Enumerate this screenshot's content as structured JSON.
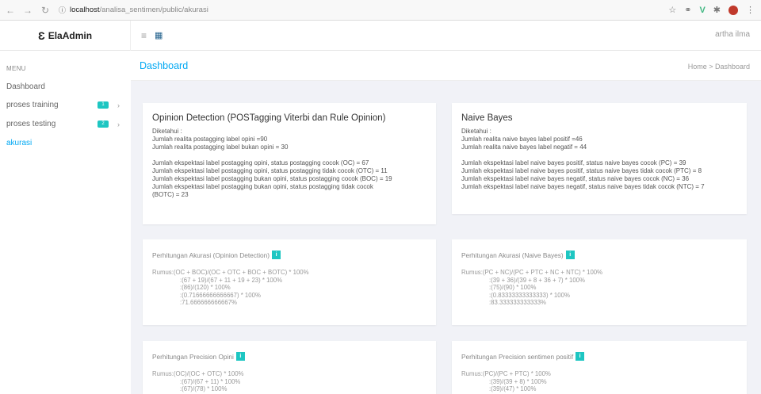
{
  "browser": {
    "host": "localhost",
    "path": "/analisa_sentimen/public/akurasi"
  },
  "header": {
    "brand": "ElaAdmin",
    "user": "artha ilma"
  },
  "sidebar": {
    "menu_title": "MENU",
    "items": [
      {
        "label": "Dashboard"
      },
      {
        "label": "proses training",
        "badge": "1"
      },
      {
        "label": "proses testing",
        "badge": "2"
      },
      {
        "label": "akurasi"
      }
    ]
  },
  "page": {
    "title": "Dashboard",
    "breadcrumb": "Home > Dashboard"
  },
  "cards": {
    "opinion": {
      "title": "Opinion Detection (POSTagging Viterbi dan Rule Opinion)",
      "lines": [
        "Diketahui :",
        "Jumlah realita postagging label opini =90",
        "Jumlah realita postagging label bukan opini = 30",
        "",
        "Jumlah ekspektasi label postagging opini, status postagging cocok (OC) = 67",
        "Jumlah ekspektasi label postagging opini, status postagging tidak cocok (OTC) = 11",
        "Jumlah ekspektasi label postagging bukan opini, status postagging cocok (BOC) = 19",
        "Jumlah ekspektasi label postagging bukan opini, status postagging tidak cocok",
        "(BOTC) = 23"
      ]
    },
    "naive": {
      "title": "Naive Bayes",
      "lines": [
        "Diketahui :",
        "Jumlah realita naive bayes label positif =46",
        "Jumlah realita naive bayes label negatif = 44",
        "",
        "Jumlah ekspektasi label naive bayes positif, status naive bayes cocok (PC) = 39",
        "Jumlah ekspektasi label naive bayes positif, status naive bayes tidak cocok (PTC) = 8",
        "Jumlah ekspektasi label naive bayes negatif, status naive bayes cocok (NC) = 36",
        "Jumlah ekspektasi label naive bayes negatif, status naive bayes tidak cocok (NTC) = 7"
      ]
    },
    "acc_opinion": {
      "subtitle": "Perhitungan Akurasi (Opinion Detection)",
      "formula_head": "Rumus:(OC + BOC)/(OC + OTC + BOC + BOTC) * 100%",
      "formula_steps": [
        ":(67 + 19)/(67 + 11 + 19 + 23) * 100%",
        ":(86)/(120) * 100%",
        ":(0.71666666666667) * 100%",
        ":71.666666666667%"
      ]
    },
    "acc_naive": {
      "subtitle": "Perhitungan Akurasi (Naive Bayes)",
      "formula_head": "Rumus:(PC + NC)/(PC + PTC + NC + NTC) * 100%",
      "formula_steps": [
        ":(39 + 36)/(39 + 8 + 36 + 7) * 100%",
        ":(75)/(90) * 100%",
        ":(0.83333333333333) * 100%",
        ":83.333333333333%"
      ]
    },
    "prec_opinion": {
      "subtitle": "Perhitungan Precision Opini",
      "formula_head": "Rumus:(OC)/(OC + OTC) * 100%",
      "formula_steps": [
        ":(67)/(67 + 11) * 100%",
        ":(67)/(78) * 100%"
      ]
    },
    "prec_naive": {
      "subtitle": "Perhitungan Precision sentimen positif",
      "formula_head": "Rumus:(PC)/(PC + PTC) * 100%",
      "formula_steps": [
        ":(39)/(39 + 8) * 100%",
        ":(39)/(47) * 100%"
      ]
    }
  },
  "colors": {
    "accent": "#03a9f3",
    "badge": "#1ec6c2"
  }
}
